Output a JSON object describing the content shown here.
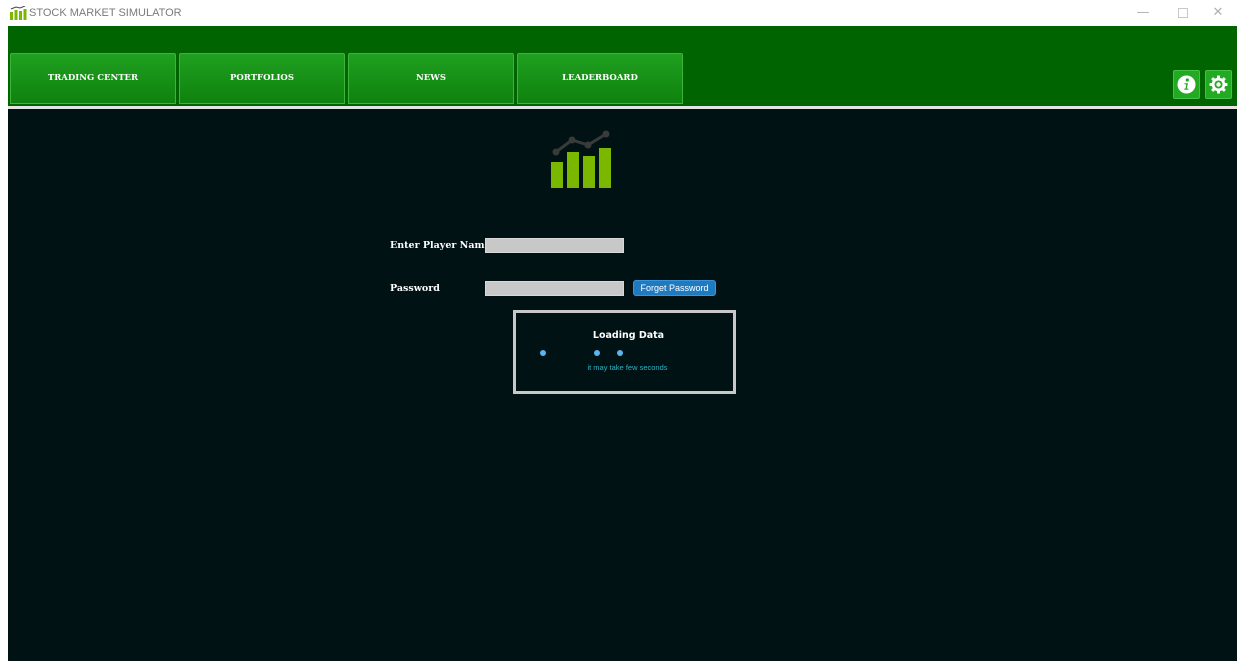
{
  "window": {
    "title": "STOCK MARKET SIMULATOR",
    "controls": {
      "minimize": "—",
      "close": "✕"
    }
  },
  "nav": {
    "tabs": [
      {
        "label": "TRADING CENTER"
      },
      {
        "label": "PORTFOLIOS"
      },
      {
        "label": "NEWS"
      },
      {
        "label": "LEADERBOARD"
      }
    ],
    "icons": [
      "info-icon",
      "gear-icon"
    ]
  },
  "login": {
    "player_name_label": "Enter Player Name",
    "player_name_value": "",
    "password_label": "Password",
    "password_value": "",
    "forget_password_label": "Forget Password"
  },
  "loading": {
    "title": "Loading Data",
    "subtitle": "it may take few seconds"
  },
  "colors": {
    "navbar": "#006400",
    "tab": "#1a961a",
    "background": "#001214",
    "accent_blue": "#1f7ac0",
    "dot": "#5ab4f0",
    "logo_bar": "#7ab800"
  }
}
